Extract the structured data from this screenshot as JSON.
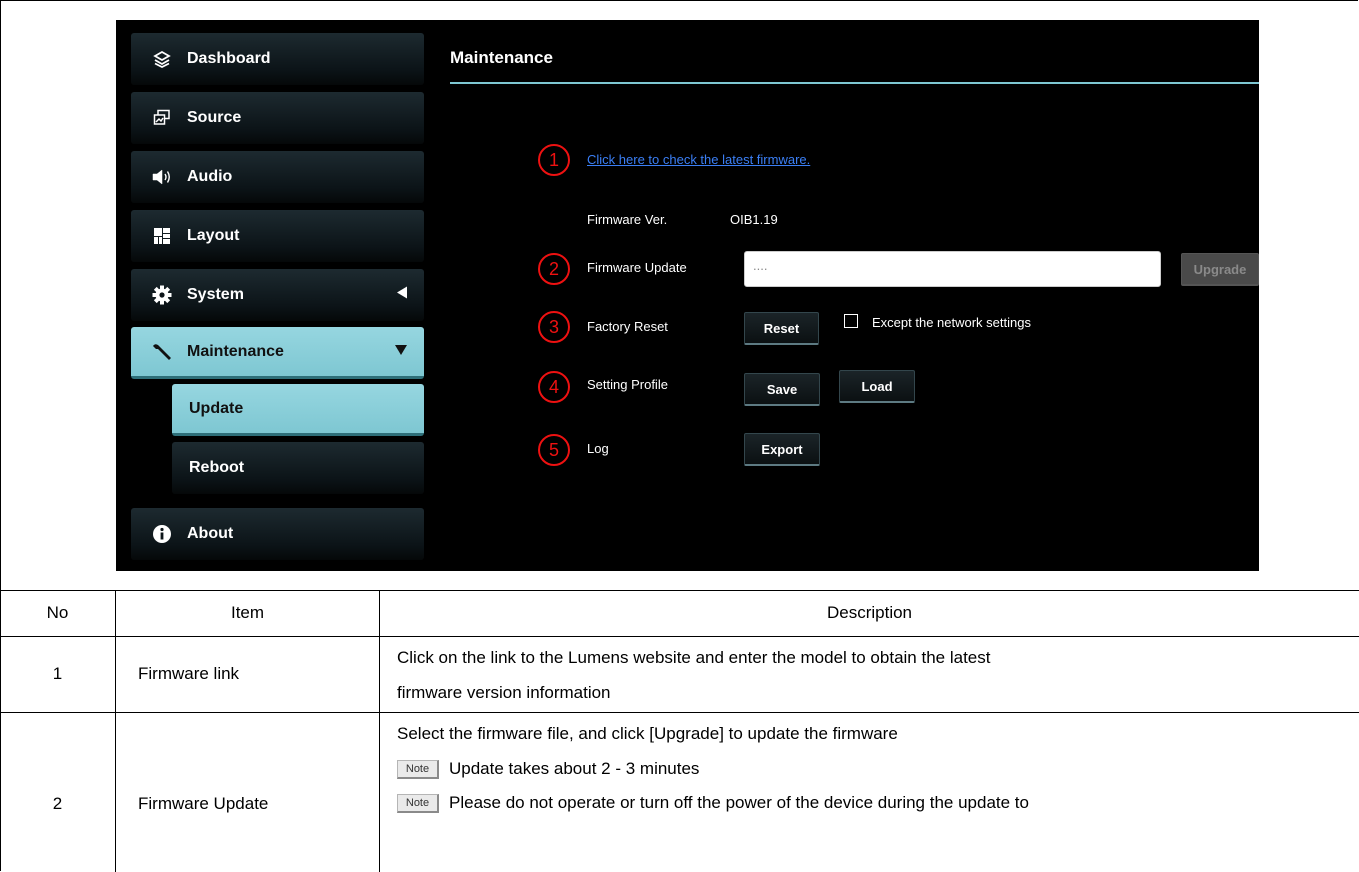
{
  "sidebar": {
    "items": [
      {
        "label": "Dashboard",
        "icon": "layers-icon"
      },
      {
        "label": "Source",
        "icon": "source-icon"
      },
      {
        "label": "Audio",
        "icon": "speaker-icon"
      },
      {
        "label": "Layout",
        "icon": "grid-icon"
      },
      {
        "label": "System",
        "icon": "gear-icon"
      },
      {
        "label": "Maintenance",
        "icon": "wrench-icon"
      },
      {
        "label": "About",
        "icon": "info-icon"
      }
    ],
    "sub_items": [
      {
        "label": "Update"
      },
      {
        "label": "Reboot"
      }
    ]
  },
  "main": {
    "title": "Maintenance",
    "markers": [
      "1",
      "2",
      "3",
      "4",
      "5"
    ],
    "firmware_link": "Click here to check the latest firmware.",
    "firmware_ver_label": "Firmware Ver.",
    "firmware_ver_value": "OIB1.19",
    "firmware_update_label": "Firmware Update",
    "firmware_update_value": "....",
    "upgrade_button": "Upgrade",
    "factory_reset_label": "Factory Reset",
    "reset_button": "Reset",
    "except_network_label": "Except the network settings",
    "setting_profile_label": "Setting Profile",
    "save_button": "Save",
    "load_button": "Load",
    "log_label": "Log",
    "export_button": "Export"
  },
  "table": {
    "headers": [
      "No",
      "Item",
      "Description"
    ],
    "rows": [
      {
        "no": "1",
        "item": "Firmware link",
        "desc_line1": "Click on the link to the Lumens website and enter the model to obtain the latest",
        "desc_line2": "firmware version information"
      },
      {
        "no": "2",
        "item": "Firmware Update",
        "desc_line1": "Select the firmware file, and click [Upgrade] to update the firmware",
        "note_badge": "Note",
        "note1": "Update takes about 2 - 3 minutes",
        "note2": "Please do not operate or turn off the power of the device during the update to"
      }
    ]
  }
}
